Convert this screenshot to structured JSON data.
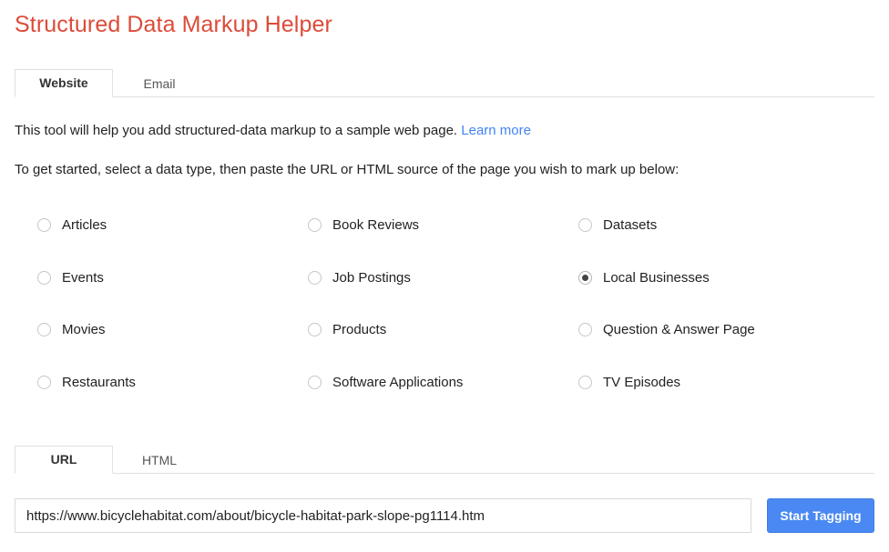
{
  "app": {
    "title": "Structured Data Markup Helper",
    "title_color": "#DD4B39"
  },
  "top_tabs": {
    "items": [
      {
        "label": "Website",
        "active": true
      },
      {
        "label": "Email",
        "active": false
      }
    ]
  },
  "intro": {
    "line1_before_link": "This tool will help you add structured-data markup to a sample web page. ",
    "learn_more_label": "Learn more",
    "line2": "To get started, select a data type, then paste the URL or HTML source of the page you wish to mark up below:"
  },
  "data_types": {
    "selected": "Local Businesses",
    "columns": [
      {
        "items": [
          {
            "label": "Articles",
            "selected": false
          },
          {
            "label": "Events",
            "selected": false
          },
          {
            "label": "Movies",
            "selected": false
          },
          {
            "label": "Restaurants",
            "selected": false
          }
        ]
      },
      {
        "items": [
          {
            "label": "Book Reviews",
            "selected": false
          },
          {
            "label": "Job Postings",
            "selected": false
          },
          {
            "label": "Products",
            "selected": false
          },
          {
            "label": "Software Applications",
            "selected": false
          }
        ]
      },
      {
        "items": [
          {
            "label": "Datasets",
            "selected": false
          },
          {
            "label": "Local Businesses",
            "selected": true
          },
          {
            "label": "Question & Answer Page",
            "selected": false
          },
          {
            "label": "TV Episodes",
            "selected": false
          }
        ]
      }
    ]
  },
  "source_tabs": {
    "items": [
      {
        "label": "URL",
        "active": true
      },
      {
        "label": "HTML",
        "active": false
      }
    ]
  },
  "url_row": {
    "value": "https://www.bicyclehabitat.com/about/bicycle-habitat-park-slope-pg1114.htm",
    "placeholder": "",
    "button_label": "Start Tagging",
    "button_color": "#4a89f3"
  }
}
